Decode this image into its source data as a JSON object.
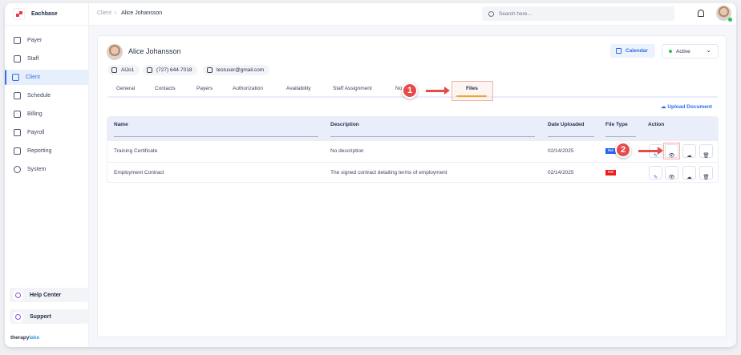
{
  "app": {
    "name": "Eachbase",
    "brand_a": "therapy",
    "brand_b": "lake"
  },
  "sidebar": {
    "items": [
      {
        "label": "Payer",
        "icon": "shield-icon"
      },
      {
        "label": "Staff",
        "icon": "staff-icon"
      },
      {
        "label": "Client",
        "icon": "user-icon",
        "active": true
      },
      {
        "label": "Schedule",
        "icon": "calendar-icon"
      },
      {
        "label": "Billing",
        "icon": "billing-icon"
      },
      {
        "label": "Payroll",
        "icon": "payroll-icon"
      },
      {
        "label": "Reporting",
        "icon": "report-icon"
      },
      {
        "label": "System",
        "icon": "gear-icon"
      }
    ],
    "help": "Help Center",
    "support": "Support"
  },
  "header": {
    "breadcrumb": [
      "Client",
      "Alice Johansson"
    ],
    "search_placeholder": "Search here..."
  },
  "client": {
    "name": "Alice Johansson",
    "id": "AlJo1",
    "phone": "(727) 644-7018",
    "email": "testuser@gmail.com",
    "calendar": "Calendar",
    "status": "Active",
    "status_color": "#22c55e"
  },
  "tabs": [
    "General",
    "Contacts",
    "Payers",
    "Authorization",
    "Availability",
    "Staff Assignment",
    "No",
    "Files"
  ],
  "active_tab": "Files",
  "upload": "Upload Document",
  "table": {
    "columns": [
      "Name",
      "Description",
      "Date Uploaded",
      "File Type",
      "Action"
    ],
    "rows": [
      {
        "name": "Training Certificate",
        "description": "No description",
        "date": "02/14/2025",
        "type": "PNG",
        "type_color": "#2563eb"
      },
      {
        "name": "Employment Contract",
        "description": "The signed contract detailing terms of employment",
        "date": "02/14/2025",
        "type": "PDF",
        "type_color": "#ef1c1c"
      }
    ]
  },
  "annotations": [
    "1",
    "2"
  ],
  "accent": "#2e6ee6"
}
